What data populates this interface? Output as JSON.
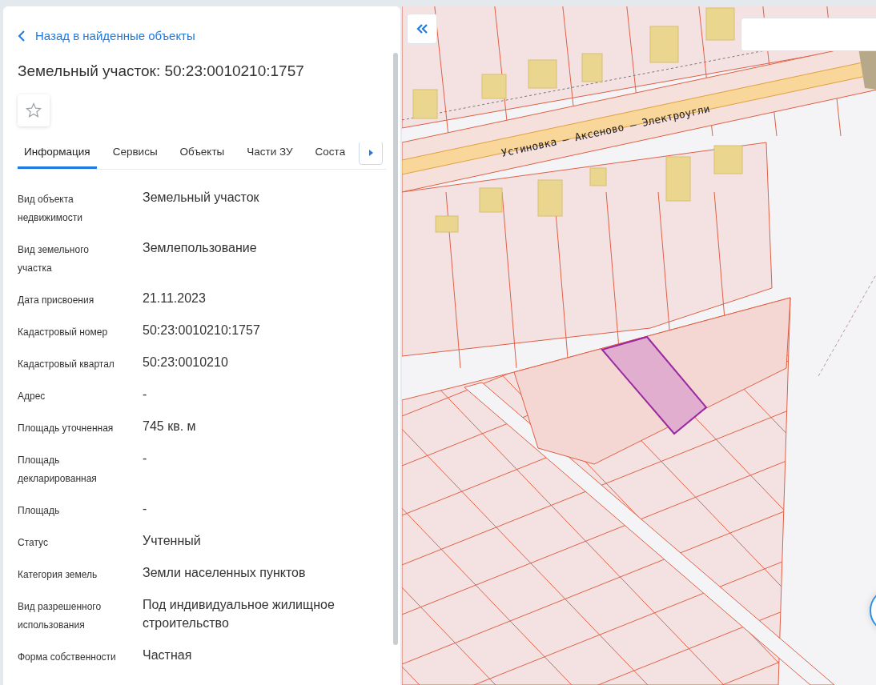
{
  "back_link": {
    "label": "Назад в найденные объекты"
  },
  "title": "Земельный участок: 50:23:0010210:1757",
  "favorite": {
    "on": false
  },
  "tabs": [
    {
      "label": "Информация",
      "selected": true
    },
    {
      "label": "Сервисы",
      "selected": false
    },
    {
      "label": "Объекты",
      "selected": false
    },
    {
      "label": "Части ЗУ",
      "selected": false
    },
    {
      "label": "Соста",
      "selected": false
    }
  ],
  "fields": [
    {
      "label": "Вид объекта недвижимости",
      "value": "Земельный участок"
    },
    {
      "label": "Вид земельного участка",
      "value": "Землепользование"
    },
    {
      "label": "Дата присвоения",
      "value": "21.11.2023"
    },
    {
      "label": "Кадастровый номер",
      "value": "50:23:0010210:1757"
    },
    {
      "label": "Кадастровый квартал",
      "value": "50:23:0010210"
    },
    {
      "label": "Адрес",
      "value": "-"
    },
    {
      "label": "Площадь уточненная",
      "value": "745 кв. м"
    },
    {
      "label": "Площадь декларированная",
      "value": "-"
    },
    {
      "label": "Площадь",
      "value": "-"
    },
    {
      "label": "Статус",
      "value": "Учтенный"
    },
    {
      "label": "Категория земель",
      "value": "Земли населенных пунктов"
    },
    {
      "label": "Вид разрешенного использования",
      "value": "Под индивидуальное жилищное строительство"
    },
    {
      "label": "Форма собственности",
      "value": "Частная"
    }
  ],
  "map": {
    "road_label": "Устиновка – Аксеново – Электроугли"
  }
}
